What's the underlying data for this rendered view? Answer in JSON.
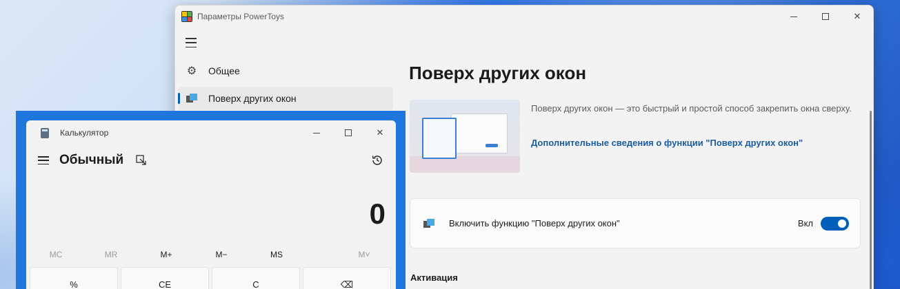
{
  "powertoys": {
    "title": "Параметры PowerToys",
    "nav": [
      {
        "label": "Общее",
        "icon": "gear-icon"
      },
      {
        "label": "Поверх других окон",
        "icon": "always-on-top-icon",
        "active": true
      }
    ],
    "page_title": "Поверх других окон",
    "description": "Поверх других окон — это быстрый и простой способ закрепить окна сверху.",
    "learn_more_link": "Дополнительные сведения о функции \"Поверх других окон\"",
    "enable_setting": {
      "label": "Включить функцию \"Поверх других окон\"",
      "state_label": "Вкл",
      "enabled": true
    },
    "section_activation": "Активация"
  },
  "calculator": {
    "title": "Калькулятор",
    "mode": "Обычный",
    "display_value": "0",
    "memory_buttons": [
      {
        "label": "MC",
        "enabled": false
      },
      {
        "label": "MR",
        "enabled": false
      },
      {
        "label": "M+",
        "enabled": true
      },
      {
        "label": "M−",
        "enabled": true
      },
      {
        "label": "MS",
        "enabled": true
      },
      {
        "label": "M˅",
        "enabled": false
      }
    ],
    "keys_row1": [
      "%",
      "CE",
      "C",
      "⌫"
    ]
  },
  "colors": {
    "accent": "#005fb8",
    "link": "#1a5c9e",
    "calc_frame": "#1f76dc"
  }
}
